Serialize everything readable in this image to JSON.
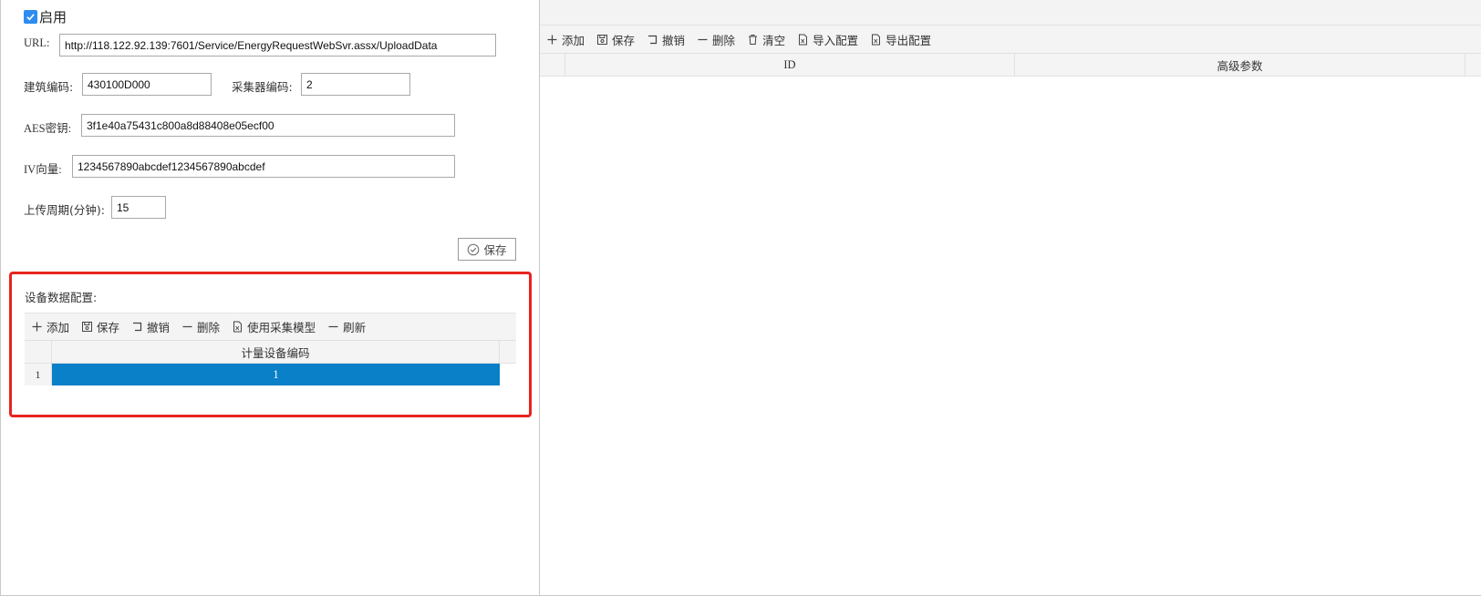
{
  "form": {
    "enable_label": "启用",
    "url_label": "URL:",
    "url_value": "http://118.122.92.139:7601/Service/EnergyRequestWebSvr.assx/UploadData",
    "building_code_label": "建筑编码:",
    "building_code_value": "430100D000",
    "collector_code_label": "采集器编码:",
    "collector_code_value": "2",
    "aes_key_label": "AES密钥:",
    "aes_key_value": "3f1e40a75431c800a8d88408e05ecf00",
    "iv_label": "IV向量:",
    "iv_value": "1234567890abcdef1234567890abcdef",
    "upload_period_label": "上传周期(分钟):",
    "upload_period_value": "15",
    "save_label": "保存"
  },
  "device_config": {
    "title": "设备数据配置:",
    "toolbar": {
      "add": "添加",
      "save": "保存",
      "undo": "撤销",
      "delete": "删除",
      "use_model": "使用采集模型",
      "refresh": "刷新"
    },
    "columns": [
      "计量设备编码"
    ],
    "rows": [
      {
        "row_number": "1",
        "code": "1"
      }
    ]
  },
  "right_panel": {
    "toolbar": {
      "add": "添加",
      "save": "保存",
      "undo": "撤销",
      "delete": "删除",
      "clear": "清空",
      "import": "导入配置",
      "export": "导出配置"
    },
    "columns": [
      "ID",
      "高级参数"
    ]
  },
  "colors": {
    "selected_row": "#0980c8",
    "highlight_border": "#e8231e",
    "checkbox": "#2d8cf0"
  }
}
